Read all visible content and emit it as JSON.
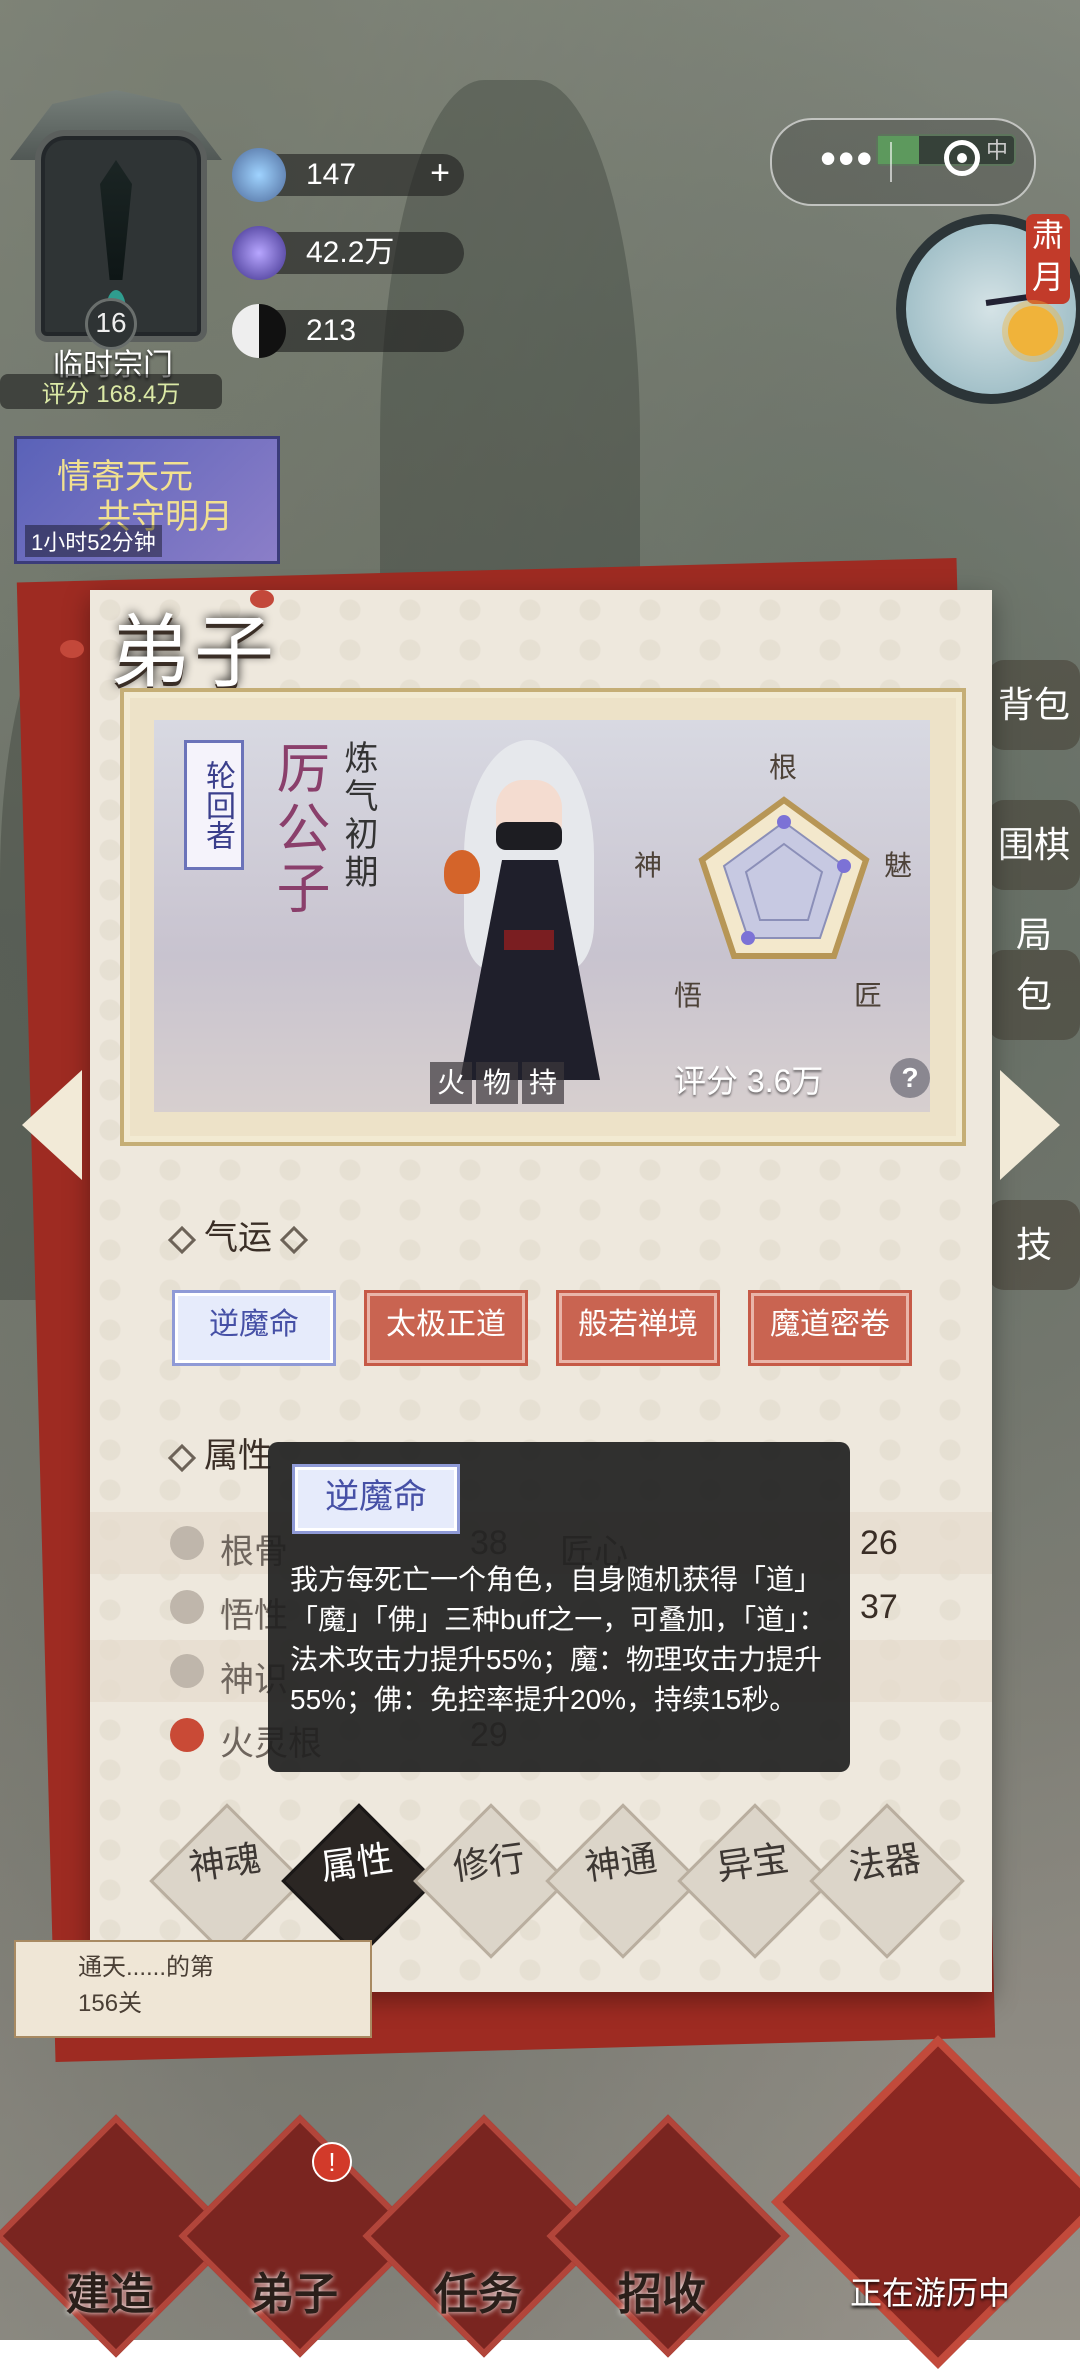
{
  "hud": {
    "sect_level": "16",
    "sect_name": "临时宗门",
    "sect_score": "评分 168.4万",
    "resources": [
      {
        "icon": "cloud-spirit-icon",
        "value": "147",
        "has_plus": true
      },
      {
        "icon": "spirit-crystal-icon",
        "value": "42.2万"
      },
      {
        "icon": "yin-yang-icon",
        "value": "213"
      }
    ],
    "event_banner": {
      "line1": "情寄天元",
      "line2": "共守明月",
      "timer": "1小时52分钟"
    },
    "progress_label": "中",
    "season": "肃月"
  },
  "dialog": {
    "title": "弟子",
    "disciple": {
      "rank": "轮回者",
      "name": "厉公子",
      "realm": "炼气初期",
      "tags": [
        "火",
        "物",
        "持"
      ],
      "score": "评分 3.6万",
      "radar_labels": [
        "根",
        "魅",
        "匠",
        "悟",
        "神"
      ]
    },
    "fortune_header": "气运",
    "fortunes": [
      "逆魔命",
      "太极正道",
      "般若禅境",
      "魔道密卷"
    ],
    "attributes_header": "属性",
    "attributes": [
      {
        "name": "根骨",
        "value": "38",
        "name2": "匠心",
        "value2": "26"
      },
      {
        "name": "悟性",
        "value": "",
        "name2": "",
        "value2": "37"
      },
      {
        "name": "神识",
        "value": "",
        "name2": "",
        "value2": ""
      },
      {
        "name": "火灵根",
        "value": "29",
        "name2": "",
        "value2": ""
      }
    ],
    "tooltip": {
      "title": "逆魔命",
      "text": "我方每死亡一个角色，自身随机获得「道」「魔」「佛」三种buff之一，可叠加，「道」：法术攻击力提升55%；魔：物理攻击力提升55%；佛：免控率提升20%，持续15秒。"
    },
    "tabs": [
      "神魂",
      "属性",
      "修行",
      "神通",
      "异宝",
      "法器"
    ],
    "selected_tab": "属性"
  },
  "side_right": [
    "背包",
    "围棋局",
    "包",
    "技"
  ],
  "quest_scroll": {
    "text": "通天......的第",
    "sub": "156关"
  },
  "bottom_nav": {
    "items": [
      "建造",
      "弟子",
      "任务",
      "招收"
    ],
    "notification": "!",
    "travel": "正在游历中"
  },
  "colors": {
    "accent_red": "#c96451",
    "selected_blue": "#4650a6",
    "dark": "#2b2623"
  }
}
